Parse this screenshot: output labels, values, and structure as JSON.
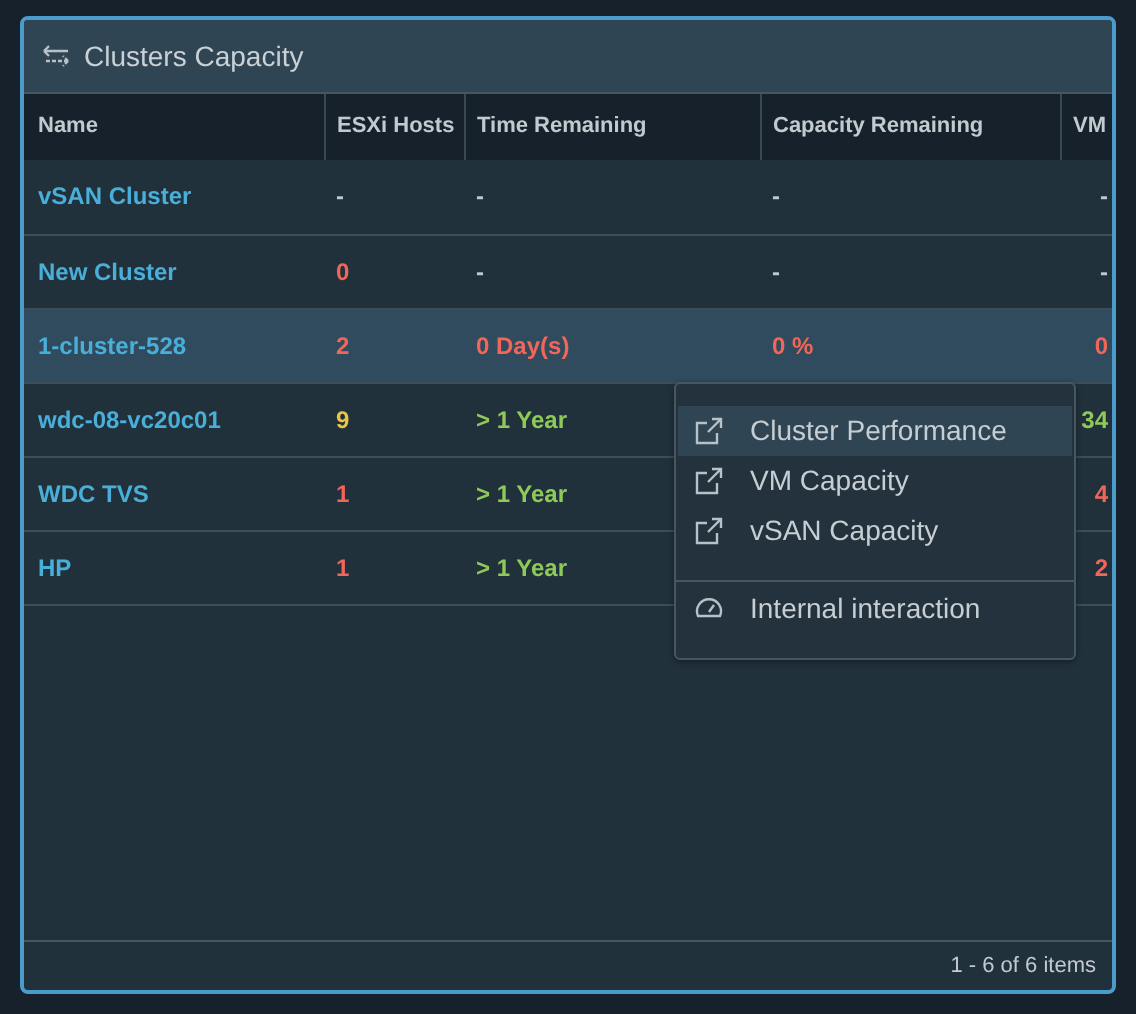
{
  "panel": {
    "title": "Clusters Capacity"
  },
  "table": {
    "columns": [
      "Name",
      "ESXi Hosts",
      "Time Remaining",
      "Capacity Remaining",
      "VM"
    ],
    "rows": [
      {
        "selected": false,
        "cells": [
          {
            "text": "vSAN Cluster",
            "color": "#49afd9"
          },
          {
            "text": "-",
            "color": "#c3cacf"
          },
          {
            "text": "-",
            "color": "#c3cacf"
          },
          {
            "text": "-",
            "color": "#c3cacf"
          },
          {
            "text": "-",
            "color": "#c3cacf"
          }
        ]
      },
      {
        "selected": false,
        "cells": [
          {
            "text": "New Cluster",
            "color": "#49afd9"
          },
          {
            "text": "0",
            "color": "#f0675a"
          },
          {
            "text": "-",
            "color": "#c3cacf"
          },
          {
            "text": "-",
            "color": "#c3cacf"
          },
          {
            "text": "-",
            "color": "#c3cacf"
          }
        ]
      },
      {
        "selected": true,
        "cells": [
          {
            "text": "1-cluster-528",
            "color": "#49afd9"
          },
          {
            "text": "2",
            "color": "#f0675a"
          },
          {
            "text": "0 Day(s)",
            "color": "#f0675a"
          },
          {
            "text": "0 %",
            "color": "#f0675a"
          },
          {
            "text": "0",
            "color": "#f0675a"
          }
        ]
      },
      {
        "selected": false,
        "cells": [
          {
            "text": "wdc-08-vc20c01",
            "color": "#49afd9"
          },
          {
            "text": "9",
            "color": "#e9c54a"
          },
          {
            "text": "> 1 Year",
            "color": "#8fc95a"
          },
          {
            "text": "34",
            "color": "#8fc95a"
          }
        ]
      },
      {
        "selected": false,
        "cells": [
          {
            "text": "WDC TVS",
            "color": "#49afd9"
          },
          {
            "text": "1",
            "color": "#f0675a"
          },
          {
            "text": "> 1 Year",
            "color": "#8fc95a"
          },
          {
            "text": "4",
            "color": "#f0675a"
          }
        ]
      },
      {
        "selected": false,
        "cells": [
          {
            "text": "HP",
            "color": "#49afd9"
          },
          {
            "text": "1",
            "color": "#f0675a"
          },
          {
            "text": "> 1 Year",
            "color": "#8fc95a"
          },
          {
            "text": "2",
            "color": "#f0675a"
          }
        ]
      }
    ],
    "footer": "1 - 6 of 6 items"
  },
  "context_menu": {
    "items": [
      {
        "label": "Cluster Performance",
        "kind": "link",
        "selected": true
      },
      {
        "label": "VM Capacity",
        "kind": "link",
        "selected": false
      },
      {
        "label": "vSAN Capacity",
        "kind": "link",
        "selected": false
      },
      {
        "label": "Internal interaction",
        "kind": "action",
        "selected": false
      }
    ]
  }
}
